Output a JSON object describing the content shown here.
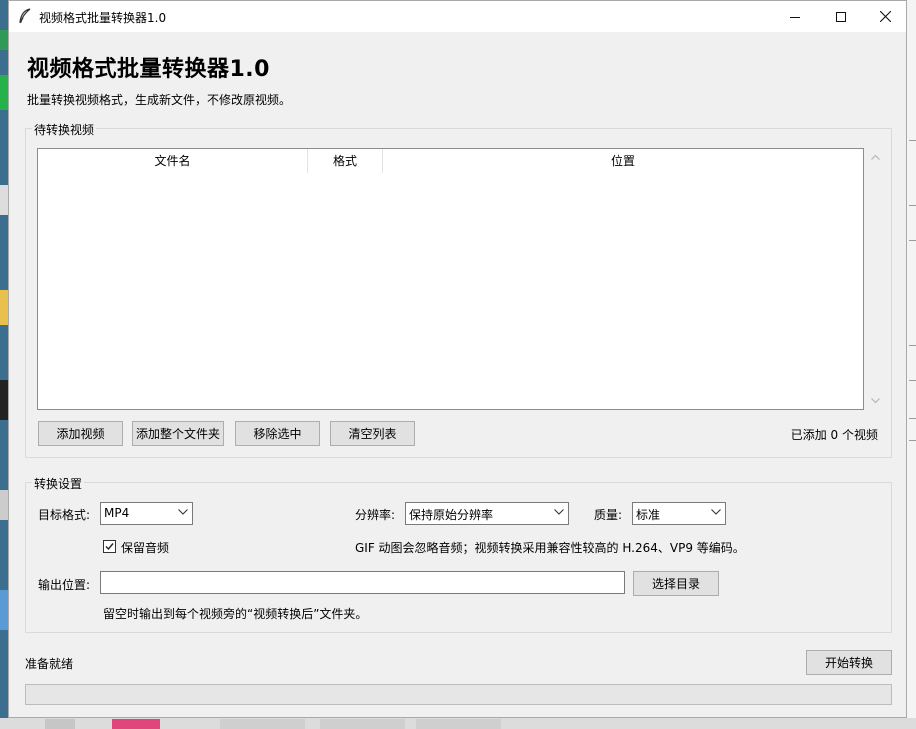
{
  "window": {
    "title": "视频格式批量转换器1.0",
    "controls": {
      "minimize": "minimize",
      "maximize": "maximize",
      "close": "close"
    }
  },
  "header": {
    "title": "视频格式批量转换器1.0",
    "subtitle": "批量转换视频格式，生成新文件，不修改原视频。"
  },
  "pending": {
    "label": "待转换视频",
    "columns": [
      "文件名",
      "格式",
      "位置"
    ],
    "rows": [],
    "buttons": {
      "add_video": "添加视频",
      "add_folder": "添加整个文件夹",
      "remove_selected": "移除选中",
      "clear_list": "清空列表"
    },
    "count_text": "已添加 0 个视频"
  },
  "settings": {
    "label": "转换设置",
    "target_format_label": "目标格式:",
    "target_format_value": "MP4",
    "resolution_label": "分辨率:",
    "resolution_value": "保持原始分辨率",
    "quality_label": "质量:",
    "quality_value": "标准",
    "keep_audio_label": "保留音频",
    "keep_audio_checked": true,
    "gif_note": "GIF 动图会忽略音频；视频转换采用兼容性较高的 H.264、VP9 等编码。",
    "output_label": "输出位置:",
    "output_value": "",
    "choose_dir_label": "选择目录",
    "output_hint": "留空时输出到每个视频旁的“视频转换后”文件夹。"
  },
  "status": {
    "text": "准备就绪",
    "start_label": "开始转换",
    "progress": 0
  }
}
